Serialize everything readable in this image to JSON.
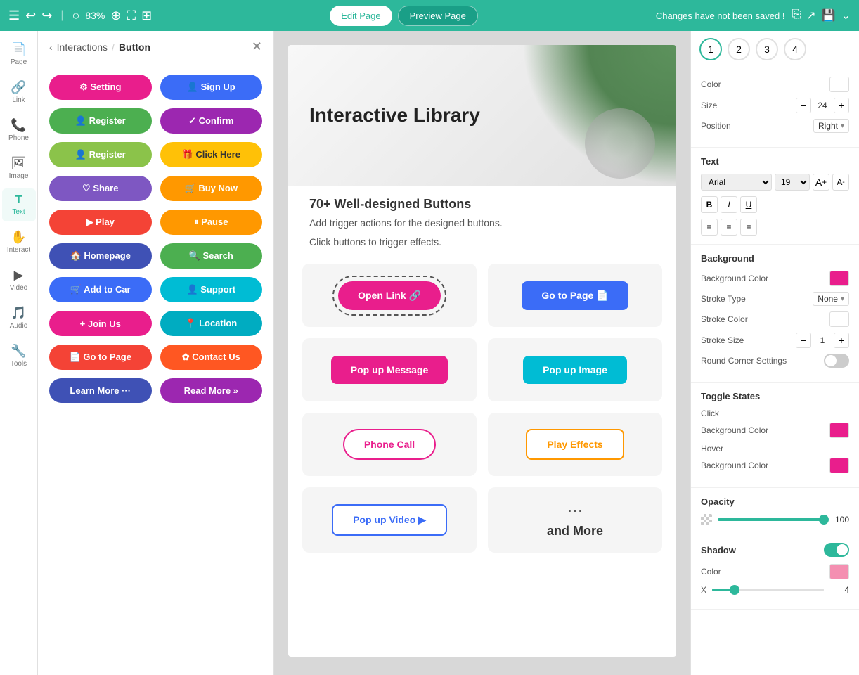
{
  "topbar": {
    "zoom": "83%",
    "edit_label": "Edit Page",
    "preview_label": "Preview Page",
    "unsaved_message": "Changes have not been saved !"
  },
  "left_panel": {
    "breadcrumb_back": "Interactions",
    "breadcrumb_current": "Button",
    "buttons": [
      {
        "label": "Setting",
        "icon": "⚙",
        "style": "pink"
      },
      {
        "label": "Sign Up",
        "icon": "👤",
        "style": "blue"
      },
      {
        "label": "Register",
        "icon": "👤",
        "style": "green"
      },
      {
        "label": "Confirm",
        "icon": "✓",
        "style": "purple"
      },
      {
        "label": "Register",
        "icon": "👤",
        "style": "green"
      },
      {
        "label": "Click Here",
        "icon": "🎁",
        "style": "orange"
      },
      {
        "label": "Share",
        "icon": "♡",
        "style": "purple"
      },
      {
        "label": "Buy Now",
        "icon": "🛒",
        "style": "orange"
      },
      {
        "label": "Play",
        "icon": "▶",
        "style": "red"
      },
      {
        "label": "Pause",
        "icon": "⏸",
        "style": "orange"
      },
      {
        "label": "Homepage",
        "icon": "🏠",
        "style": "indigo"
      },
      {
        "label": "Search",
        "icon": "🔍",
        "style": "green"
      },
      {
        "label": "Add to Car",
        "icon": "🛒",
        "style": "indigo"
      },
      {
        "label": "Support",
        "icon": "👤",
        "style": "teal"
      },
      {
        "label": "Join Us",
        "icon": "+",
        "style": "pink"
      },
      {
        "label": "Location",
        "icon": "📍",
        "style": "cyan"
      },
      {
        "label": "Go to Page",
        "icon": "📄",
        "style": "red"
      },
      {
        "label": "Contact Us",
        "icon": "✿",
        "style": "deep-orange"
      },
      {
        "label": "Learn More",
        "icon": "···",
        "style": "indigo"
      },
      {
        "label": "Read More",
        "icon": "»",
        "style": "purple"
      }
    ]
  },
  "canvas": {
    "title": "Interactive Library",
    "subtitle1": "70+ Well-designed Buttons",
    "subtitle2": "Add trigger actions for the designed buttons.",
    "subtitle3": "Click buttons to trigger effects.",
    "btn_open_link": "Open Link 🔗",
    "btn_goto_page": "Go to Page 📄",
    "btn_popup_msg": "Pop up Message",
    "btn_popup_img": "Pop up Image",
    "btn_phone": "Phone Call",
    "btn_play_effects": "Play Effects",
    "btn_popup_video": "Pop up Video ▶",
    "btn_and_more": "and More"
  },
  "right_panel": {
    "color_label": "Color",
    "size_label": "Size",
    "size_value": "24",
    "position_label": "Position",
    "position_value": "Right",
    "text_label": "Text",
    "font_value": "Arial",
    "font_size": "19",
    "background_label": "Background",
    "bg_color_label": "Background Color",
    "stroke_type_label": "Stroke Type",
    "stroke_type_value": "None",
    "stroke_color_label": "Stroke Color",
    "stroke_size_label": "Stroke Size",
    "stroke_size_value": "1",
    "round_corner_label": "Round Corner Settings",
    "toggle_states_label": "Toggle States",
    "click_label": "Click",
    "bg_color_click_label": "Background Color",
    "hover_label": "Hover",
    "bg_color_hover_label": "Background Color",
    "opacity_label": "Opacity",
    "opacity_value": "100",
    "shadow_label": "Shadow",
    "shadow_color_label": "Color",
    "shadow_x_label": "X",
    "shadow_x_value": "4"
  },
  "icon_sidebar": [
    {
      "label": "Page",
      "icon": "📄"
    },
    {
      "label": "Link",
      "icon": "🔗"
    },
    {
      "label": "Phone",
      "icon": "📞"
    },
    {
      "label": "Image",
      "icon": "🖼"
    },
    {
      "label": "Text",
      "icon": "T"
    },
    {
      "label": "Interact",
      "icon": "✋"
    },
    {
      "label": "Video",
      "icon": "▶"
    },
    {
      "label": "Audio",
      "icon": "🎵"
    },
    {
      "label": "Tools",
      "icon": "🔧"
    }
  ]
}
